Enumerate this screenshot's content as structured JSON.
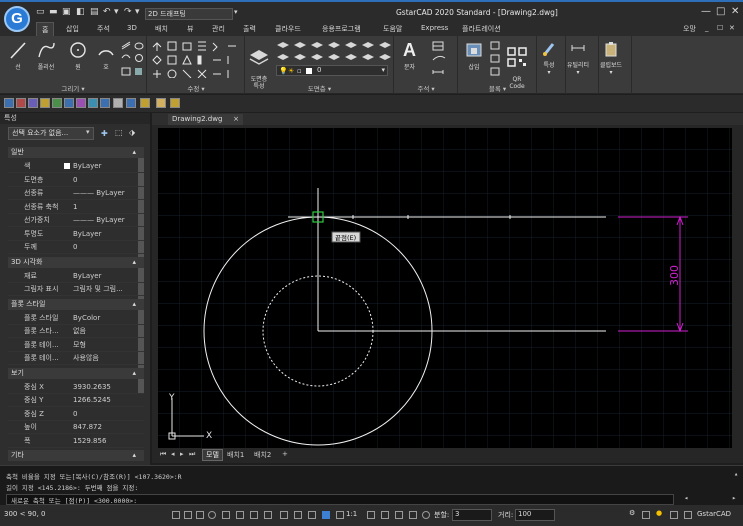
{
  "app": {
    "logo_letter": "G",
    "title": "GstarCAD 2020 Standard - [Drawing2.dwg]",
    "workspace": "2D 드래프팅",
    "window_controls": [
      "—",
      "□",
      "✕"
    ],
    "user": "오망",
    "mini_controls": [
      "—",
      "_",
      "☐",
      "✕"
    ]
  },
  "ribbon_tabs": [
    "홈",
    "삽입",
    "주석",
    "3D",
    "배치",
    "뷰",
    "관리",
    "출력",
    "클라우드",
    "응용프로그램",
    "도움말",
    "Express",
    "플라트레이션"
  ],
  "ribbon": {
    "draw": {
      "label": "그리기",
      "buttons": [
        "선",
        "폴리선",
        "원",
        "호"
      ]
    },
    "modify": {
      "label": "수정"
    },
    "layers": {
      "label": "도면층",
      "button": "도면층\n특성",
      "layer_value": "0"
    },
    "annotation": {
      "label": "주석",
      "buttons": [
        "문자"
      ]
    },
    "block": {
      "label": "블록",
      "buttons": [
        "삽입",
        "QR\nCode"
      ]
    },
    "properties": {
      "buttons": [
        "특성"
      ]
    },
    "utilities": {
      "buttons": [
        "유틸리티"
      ]
    },
    "clipboard": {
      "buttons": [
        "클립보드"
      ]
    }
  },
  "properties_panel": {
    "title": "특성",
    "selection": "선택 요소가 없음...",
    "sections": [
      {
        "name": "일반",
        "rows": [
          [
            "색",
            "ByLayer"
          ],
          [
            "도면층",
            "0"
          ],
          [
            "선종류",
            "——— ByLayer"
          ],
          [
            "선종류 축척",
            "1"
          ],
          [
            "선가중치",
            "——— ByLayer"
          ],
          [
            "투명도",
            "ByLayer"
          ],
          [
            "두께",
            "0"
          ]
        ]
      },
      {
        "name": "3D 시각화",
        "rows": [
          [
            "재료",
            "ByLayer"
          ],
          [
            "그림자 표시",
            "그림자 및 그림..."
          ]
        ]
      },
      {
        "name": "플롯 스타일",
        "rows": [
          [
            "플롯 스타일",
            "ByColor"
          ],
          [
            "플롯 스타...",
            "없음"
          ],
          [
            "플롯 테이...",
            "모형"
          ],
          [
            "플롯 테이...",
            "사용않음"
          ]
        ]
      },
      {
        "name": "보기",
        "rows": [
          [
            "중심 X",
            "3930.2635"
          ],
          [
            "중심 Y",
            "1266.5245"
          ],
          [
            "중심 Z",
            "0"
          ],
          [
            "높이",
            "847.872"
          ],
          [
            "폭",
            "1529.856"
          ]
        ]
      },
      {
        "name": "기타",
        "rows": []
      }
    ]
  },
  "document": {
    "tab": "Drawing2.dwg",
    "layout_tabs": [
      "모델",
      "배치1",
      "배치2",
      "+"
    ],
    "snap_tooltip": "끝점(E)",
    "dimension": "300",
    "ucs": {
      "x": "X",
      "y": "Y"
    }
  },
  "command": {
    "lines": [
      "축척 비율을 지정 또는[복사(C)/참조(R)] <107.3620>:R",
      "길이 지정 <145.2186>: 두번째 점을 지정:",
      "새로운 축척 또는 [점(P)] <300.0000>:"
    ]
  },
  "status": {
    "coords": "300 < 90, 0",
    "scale": "1:1",
    "dist_label": "분할:",
    "dist_value": "3",
    "dist2_label": "거리:",
    "dist2_value": "100",
    "brand": "GstarCAD"
  },
  "colors": {
    "accent": "#2a7bd6",
    "dimension": "#d020d0",
    "canvas": "#000000",
    "ribbon": "#3b3b3b"
  }
}
